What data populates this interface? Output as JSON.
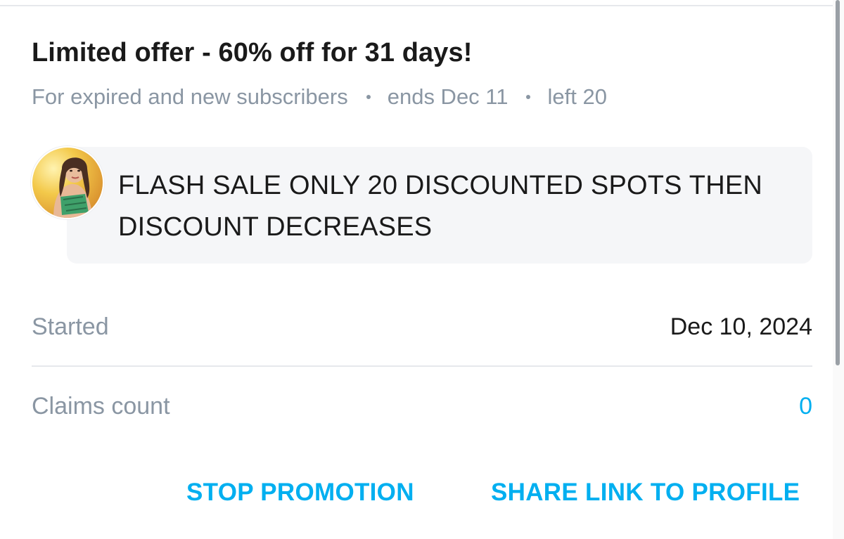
{
  "promotion": {
    "title": "Limited offer - 60% off for 31 days!",
    "audience": "For expired and new subscribers",
    "ends": "ends Dec 11",
    "left": "left 20"
  },
  "message": {
    "text": "FLASH SALE ONLY 20 DISCOUNTED SPOTS THEN DISCOUNT DECREASES",
    "avatar_icon": "profile-avatar"
  },
  "details": {
    "started_label": "Started",
    "started_value": "Dec 10, 2024",
    "claims_label": "Claims count",
    "claims_value": "0"
  },
  "actions": {
    "stop_label": "STOP PROMOTION",
    "share_label": "SHARE LINK TO PROFILE"
  },
  "colors": {
    "accent": "#00aff0",
    "muted": "#8a96a3",
    "text": "#1a1a1a",
    "bubble": "#f5f6f8"
  }
}
